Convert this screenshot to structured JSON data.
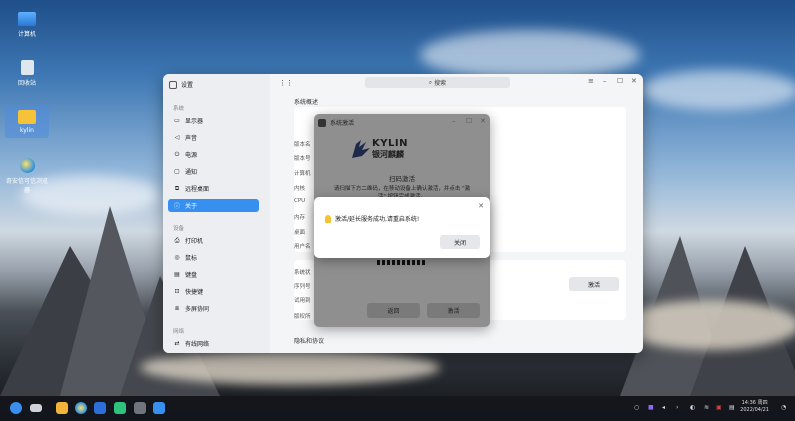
{
  "desktop": {
    "icons": [
      {
        "label": "计算机",
        "icon": "computer-icon"
      },
      {
        "label": "回收站",
        "icon": "trash-icon"
      },
      {
        "label": "kylin",
        "icon": "folder-icon"
      },
      {
        "label": "奇安信可信浏览器",
        "icon": "browser-icon"
      }
    ]
  },
  "settings": {
    "title": "设置",
    "search_placeholder": "搜索",
    "groups": [
      {
        "label": "系统",
        "items": [
          {
            "label": "显示器",
            "icon": "monitor-icon"
          },
          {
            "label": "声音",
            "icon": "speaker-icon"
          },
          {
            "label": "电源",
            "icon": "power-icon"
          },
          {
            "label": "通知",
            "icon": "notification-icon"
          },
          {
            "label": "远程桌面",
            "icon": "remote-desktop-icon"
          },
          {
            "label": "关于",
            "icon": "info-icon",
            "active": true
          }
        ]
      },
      {
        "label": "设备",
        "items": [
          {
            "label": "打印机",
            "icon": "printer-icon"
          },
          {
            "label": "鼠标",
            "icon": "mouse-icon"
          },
          {
            "label": "键盘",
            "icon": "keyboard-icon"
          },
          {
            "label": "快捷键",
            "icon": "shortcut-icon"
          },
          {
            "label": "多屏协同",
            "icon": "multiscreen-icon"
          }
        ]
      },
      {
        "label": "网络",
        "items": [
          {
            "label": "有线网络",
            "icon": "wired-network-icon"
          }
        ]
      }
    ],
    "about": {
      "overview_title": "系统概述",
      "fields": [
        "版本名",
        "版本号",
        "计算机",
        "内核",
        "CPU",
        "内存",
        "桌面",
        "用户名"
      ],
      "status_fields": [
        "系统状",
        "序列号",
        "试用到"
      ],
      "copyright_field": "版权所",
      "activate_button": "激活",
      "privacy_title": "隐私和协议"
    }
  },
  "activation": {
    "title": "系统激活",
    "brand_en": "KYLIN",
    "brand_cn": "银河麒麟",
    "scan_title": "扫码激活",
    "scan_desc_1": "请扫描下方二维码，在移动设备上确认激活，并点击 \"激",
    "scan_desc_2": "活\" 按钮完成激活。",
    "back_button": "返回",
    "activate_button": "激活"
  },
  "message": {
    "text": "激活/延长服务成功,请重启系统!",
    "close_button": "关闭"
  },
  "taskbar": {
    "time": "14:36 周四",
    "date": "2022/04/21"
  },
  "colors": {
    "accent": "#3790f0",
    "taskbar": "#14161c"
  }
}
